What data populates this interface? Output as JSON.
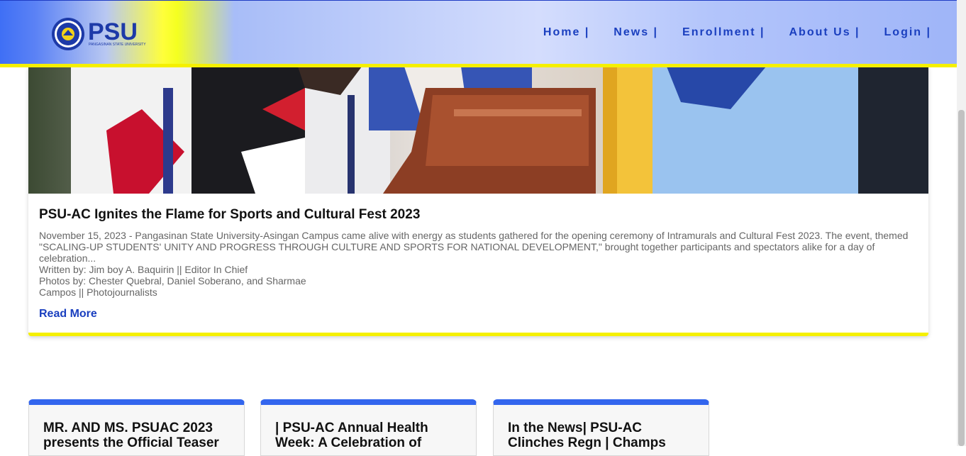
{
  "header": {
    "logo_text": "PSU",
    "logo_subtitle": "PANGASINAN STATE UNIVERSITY",
    "nav": [
      "Home |",
      "News |",
      "Enrollment |",
      "About Us |",
      "Login |"
    ]
  },
  "featured": {
    "image_icon": "ceremony-photo",
    "title": "PSU-AC Ignites the Flame for Sports and Cultural Fest 2023",
    "summary": "November 15, 2023 - Pangasinan State University-Asingan Campus came alive with energy as students gathered for the opening ceremony of Intramurals and Cultural Fest 2023. The event, themed \"SCALING-UP STUDENTS' UNITY AND PROGRESS THROUGH CULTURE AND SPORTS FOR NATIONAL DEVELOPMENT,\" brought together participants and spectators alike for a day of celebration...",
    "written_by": "Written by: Jim boy A. Baquirin || Editor In Chief",
    "photos_by": "Photos by: Chester Quebral, Daniel Soberano, and Sharmae",
    "photos_by_cont": "Campos || Photojournalists",
    "read_more": "Read More"
  },
  "cards": [
    {
      "title": "MR. AND MS. PSUAC 2023 presents the Official Teaser"
    },
    {
      "title": "| PSU-AC Annual Health Week: A Celebration of"
    },
    {
      "title": "In the News| PSU-AC Clinches Regn | Champs"
    }
  ],
  "colors": {
    "accent": "#1a3fbf",
    "yellow": "#f5f000",
    "card_top": "#3366ee"
  }
}
